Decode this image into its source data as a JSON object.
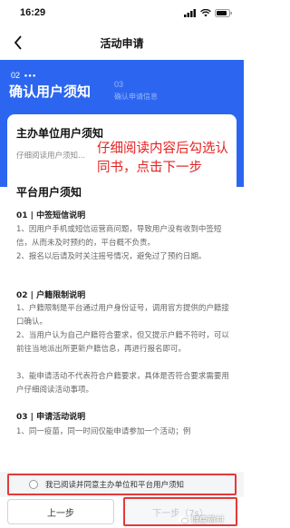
{
  "status_bar": {
    "time": "16:29"
  },
  "nav": {
    "title": "活动申请"
  },
  "steps": {
    "current_num": "02",
    "current_title": "确认用户须知",
    "next_num": "03",
    "next_title": "确认申请信息"
  },
  "content": {
    "host_title": "主办单位用户须知",
    "host_subtext": "仔细阅读用户须知...",
    "platform_title": "平台用户须知",
    "sections": [
      {
        "title": "01 | 中签短信说明",
        "paragraphs": [
          "1、因用户手机或短信运营商问题，导致用户没有收到中签短信，从而未及时预约的，平台概不负责。",
          "2、报名以后请及时关注摇号情况，避免过了预约日期。"
        ]
      },
      {
        "title": "02 | 户籍限制说明",
        "paragraphs": [
          "1、户籍限制是平台通过用户身份证号，调用官方提供的户籍接口确认。",
          "2、当用户认为自己户籍符合要求，但又提示户籍不符时，可以前往当地派出所更新户籍信息，再进行报名即可。",
          "3、能申请活动不代表符合户籍要求，具体是否符合要求需要用户仔细阅读活动事项。"
        ]
      },
      {
        "title": "03 | 申请活动说明",
        "paragraphs": [
          "1、同一疫苗，同一时间仅能申请参加一个活动；例"
        ]
      }
    ]
  },
  "annotation": "仔细阅读内容后勾选认同书，点击下一步",
  "agree": {
    "label": "我已阅读并同意主办单位和平台用户须知"
  },
  "buttons": {
    "prev": "上一步",
    "next": "下一步（7s）"
  },
  "watermark": "健康荷村"
}
